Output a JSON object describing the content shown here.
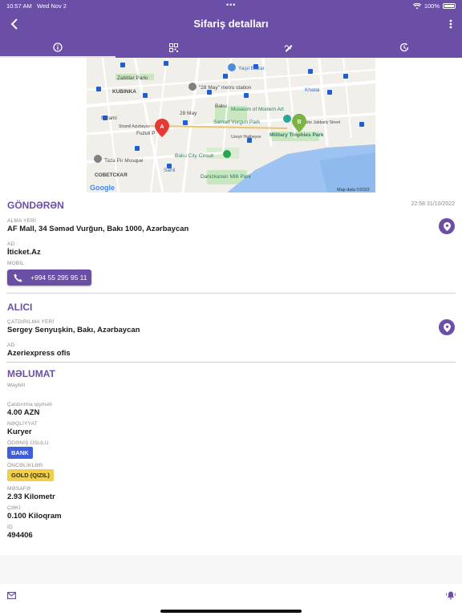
{
  "status_bar": {
    "time": "10:57 AM",
    "date": "Wed Nov 2",
    "battery": "100%"
  },
  "header": {
    "title": "Sifariş detalları"
  },
  "tabs": [
    {
      "name": "info-icon",
      "active": true
    },
    {
      "name": "qr-code-icon",
      "active": false
    },
    {
      "name": "signature-icon",
      "active": false
    },
    {
      "name": "history-icon",
      "active": false
    }
  ],
  "map": {
    "labels": {
      "zabitlar_parki": "Zabitlər Parkı",
      "yasil_bazar": "Yaşıl Bazar",
      "may28_station": "\"28 May\" metro station",
      "kubinka": "KUBINKA",
      "khatai": "Khatai",
      "nizami": "Nizami",
      "may28": "28 May",
      "baku": "Baku",
      "museum": "Museum of Modern Art",
      "samad_vurgun": "Samad Vurgun Park",
      "shamil_azizbeyov": "Shamil Azizbeyov",
      "fuzuli": "Fuzuli P",
      "jabbarly": "Jafar Jabbarly Street",
      "military_park": "Military Trophies Park",
      "uzeyir": "Uzeyir Hajibeyov",
      "taza_pir": "Taza Pir Mosque",
      "baku_city_circuit": "Baku City Circuit",
      "sovetskaya": "СОВЕТСКАЯ",
      "sahil": "Sahil",
      "danizkanari": "Danizkanarı Milli Park",
      "google": "Google",
      "map_data": "Map data ©2022",
      "pin_a": "A",
      "pin_b": "B"
    }
  },
  "sender": {
    "title": "GÖNDƏRƏN",
    "datetime": "22:58 31/10/2022",
    "pickup_label": "ALMA YERİ",
    "pickup_value": "AF Mall, 34 Səməd Vurğun, Bakı 1000, Azərbaycan",
    "name_label": "AD",
    "name_value": "İticket.Az",
    "mobile_label": "MOBİL",
    "phone": "+994 55 295 95 11"
  },
  "receiver": {
    "title": "ALICI",
    "delivery_label": "ÇATDIRILMA YERİ",
    "delivery_value": "Sergey Senyuşkin, Bakı, Azərbaycan",
    "name_label": "AD",
    "name_value": "Azeriexpress ofis"
  },
  "info": {
    "title": "MƏLUMAT",
    "waybill_label": "Waybill",
    "delivery_fee_label": "Çatdırılma qiyməti",
    "delivery_fee_value": "4.00 AZN",
    "transport_label": "NƏQLİYYAT",
    "transport_value": "Kuryer",
    "payment_label": "ÖDƏNİŞ ÜSULU",
    "payment_value": "BANK",
    "priority_label": "ÖNCƏLİKLƏR",
    "priority_value": "GOLD (QIZIL)",
    "distance_label": "MƏSAFƏ",
    "distance_value": "2.93 Kilometr",
    "weight_label": "ÇƏKİ",
    "weight_value": "0.100 Kiloqram",
    "id_label": "ID",
    "id_value": "494406"
  },
  "colors": {
    "primary": "#6b4fa7",
    "bank_badge": "#3b5fe0",
    "gold_badge": "#f2cf4a"
  }
}
